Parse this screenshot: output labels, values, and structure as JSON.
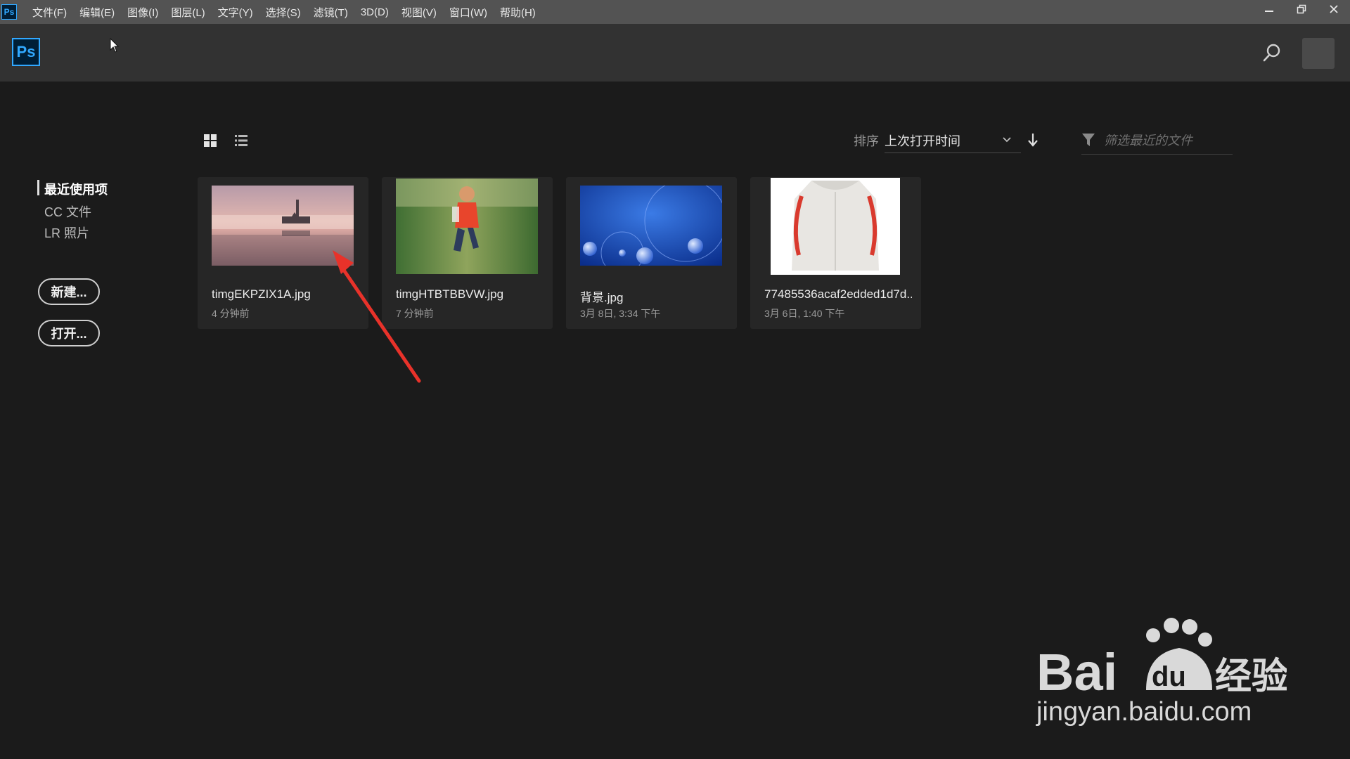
{
  "menubar": {
    "app_icon": "Ps",
    "items": [
      "文件(F)",
      "编辑(E)",
      "图像(I)",
      "图层(L)",
      "文字(Y)",
      "选择(S)",
      "滤镜(T)",
      "3D(D)",
      "视图(V)",
      "窗口(W)",
      "帮助(H)"
    ],
    "window_controls": [
      "minimize-icon",
      "restore-icon",
      "close-icon"
    ]
  },
  "header": {
    "logo": "Ps",
    "search_icon": "search-icon",
    "avatar": "avatar"
  },
  "sidebar": {
    "items": [
      {
        "label": "最近使用项",
        "active": true
      },
      {
        "label": "CC 文件",
        "active": false
      },
      {
        "label": "LR 照片",
        "active": false
      }
    ],
    "new_button": "新建...",
    "open_button": "打开..."
  },
  "toolbar": {
    "grid_view_icon": "grid-view-icon",
    "list_view_icon": "list-view-icon",
    "sort_label": "排序",
    "sort_value": "上次打开时间",
    "sort_direction_icon": "arrow-down-icon",
    "filter_icon": "funnel-icon",
    "filter_placeholder": "筛选最近的文件"
  },
  "files": [
    {
      "name": "timgEKPZIX1A.jpg",
      "time": "4 分钟前"
    },
    {
      "name": "timgHTBTBBVW.jpg",
      "time": "7 分钟前"
    },
    {
      "name": "背景.jpg",
      "time": "3月 8日, 3:34 下午"
    },
    {
      "name": "77485536acaf2edded1d7d...",
      "time": "3月 6日, 1:40 下午"
    }
  ],
  "watermark": {
    "brand": "Bai du 经验",
    "url": "jingyan.baidu.com"
  },
  "colors": {
    "accent": "#31a8ff",
    "background": "#1b1b1b",
    "annotation": "#e8322a"
  }
}
